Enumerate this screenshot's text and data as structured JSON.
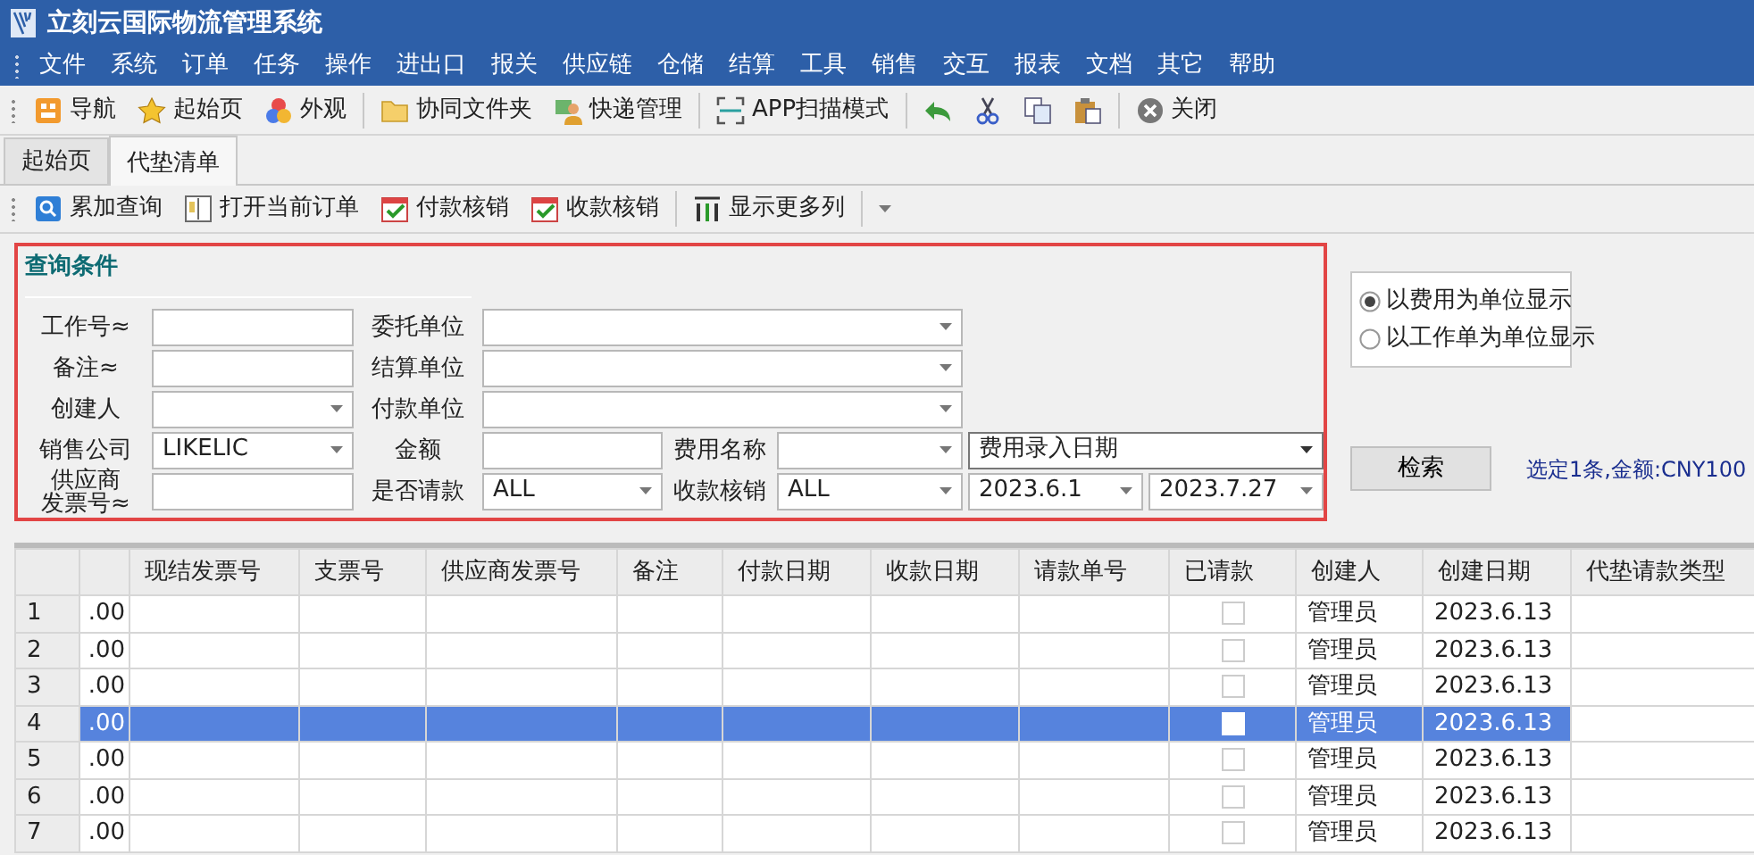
{
  "window": {
    "title": "立刻云国际物流管理系统"
  },
  "menu": [
    "文件",
    "系统",
    "订单",
    "任务",
    "操作",
    "进出口",
    "报关",
    "供应链",
    "仓储",
    "结算",
    "工具",
    "销售",
    "交互",
    "报表",
    "文档",
    "其它",
    "帮助"
  ],
  "toolbar": [
    {
      "kind": "button",
      "label": "导航"
    },
    {
      "kind": "button",
      "label": "起始页"
    },
    {
      "kind": "button",
      "label": "外观"
    },
    {
      "kind": "separator"
    },
    {
      "kind": "button",
      "label": "协同文件夹"
    },
    {
      "kind": "button",
      "label": "快递管理"
    },
    {
      "kind": "separator"
    },
    {
      "kind": "button",
      "label": "APP扫描模式"
    },
    {
      "kind": "separator"
    },
    {
      "kind": "button"
    },
    {
      "kind": "button"
    },
    {
      "kind": "button"
    },
    {
      "kind": "button"
    },
    {
      "kind": "separator"
    },
    {
      "kind": "button",
      "label": "关闭"
    }
  ],
  "tabs": [
    {
      "label": "起始页",
      "selected": false
    },
    {
      "label": "代垫清单",
      "selected": true
    }
  ],
  "subtoolbar": [
    {
      "kind": "button",
      "label": "累加查询"
    },
    {
      "kind": "button",
      "label": "打开当前订单"
    },
    {
      "kind": "button",
      "label": "付款核销"
    },
    {
      "kind": "button",
      "label": "收款核销"
    },
    {
      "kind": "separator"
    },
    {
      "kind": "button",
      "label": "显示更多列"
    },
    {
      "kind": "separator"
    },
    {
      "kind": "dropdown"
    }
  ],
  "query": {
    "legend": "查询条件",
    "rows": [
      [
        {
          "kind": "label",
          "text": "工作号≈"
        },
        {
          "kind": "text"
        },
        {
          "kind": "label",
          "text": "委托单位"
        },
        {
          "kind": "combo"
        }
      ],
      [
        {
          "kind": "label",
          "text": "备注≈"
        },
        {
          "kind": "text"
        },
        {
          "kind": "label",
          "text": "结算单位"
        },
        {
          "kind": "combo"
        }
      ],
      [
        {
          "kind": "label",
          "text": "创建人"
        },
        {
          "kind": "combo"
        },
        {
          "kind": "label",
          "text": "付款单位"
        },
        {
          "kind": "combo"
        }
      ],
      [
        {
          "kind": "label",
          "text": "销售公司"
        },
        {
          "kind": "combo",
          "value": "LIKELIC"
        },
        {
          "kind": "label",
          "text": "金额"
        },
        {
          "kind": "text"
        },
        {
          "kind": "label",
          "text": "费用名称"
        },
        {
          "kind": "combo"
        },
        {
          "kind": "select",
          "value": "费用录入日期"
        }
      ],
      [
        {
          "kind": "label",
          "text": "供应商发票号≈"
        },
        {
          "kind": "text"
        },
        {
          "kind": "label",
          "text": "是否请款"
        },
        {
          "kind": "combo",
          "value": "ALL"
        },
        {
          "kind": "label",
          "text": "收款核销"
        },
        {
          "kind": "combo",
          "value": "ALL"
        },
        {
          "kind": "combo",
          "value": "2023.6.1"
        },
        {
          "kind": "combo",
          "value": "2023.7.27"
        }
      ]
    ]
  },
  "display_mode": [
    {
      "label": "以费用为单位显示",
      "selected": true
    },
    {
      "label": "以工作单为单位显示",
      "selected": false
    }
  ],
  "search_button": "检索",
  "summary": "选定1条,金额:CNY100",
  "table": {
    "columns": [
      {
        "kind": "row_header"
      },
      {
        "kind": "number"
      },
      {
        "label": "现结发票号",
        "kind": "text"
      },
      {
        "label": "支票号",
        "kind": "text"
      },
      {
        "label": "供应商发票号",
        "kind": "text"
      },
      {
        "label": "备注",
        "kind": "text"
      },
      {
        "label": "付款日期",
        "kind": "text"
      },
      {
        "label": "收款日期",
        "kind": "text"
      },
      {
        "label": "请款单号",
        "kind": "text"
      },
      {
        "label": "已请款",
        "kind": "checkbox"
      },
      {
        "label": "创建人",
        "kind": "text"
      },
      {
        "label": "创建日期",
        "kind": "text"
      },
      {
        "label": "代垫请款类型",
        "kind": "text"
      }
    ],
    "rows": [
      {
        "number": "1",
        "amount": ".00",
        "requested": false,
        "creator": "管理员",
        "created": "2023.6.13",
        "selected": false
      },
      {
        "number": "2",
        "amount": ".00",
        "requested": false,
        "creator": "管理员",
        "created": "2023.6.13",
        "selected": false
      },
      {
        "number": "3",
        "amount": ".00",
        "requested": false,
        "creator": "管理员",
        "created": "2023.6.13",
        "selected": false
      },
      {
        "number": "4",
        "amount": ".00",
        "requested": false,
        "creator": "管理员",
        "created": "2023.6.13",
        "selected": true
      },
      {
        "number": "5",
        "amount": ".00",
        "requested": false,
        "creator": "管理员",
        "created": "2023.6.13",
        "selected": false
      },
      {
        "number": "6",
        "amount": ".00",
        "requested": false,
        "creator": "管理员",
        "created": "2023.6.13",
        "selected": false
      },
      {
        "number": "7",
        "amount": ".00",
        "requested": false,
        "creator": "管理员",
        "created": "2023.6.13",
        "selected": false
      }
    ]
  }
}
